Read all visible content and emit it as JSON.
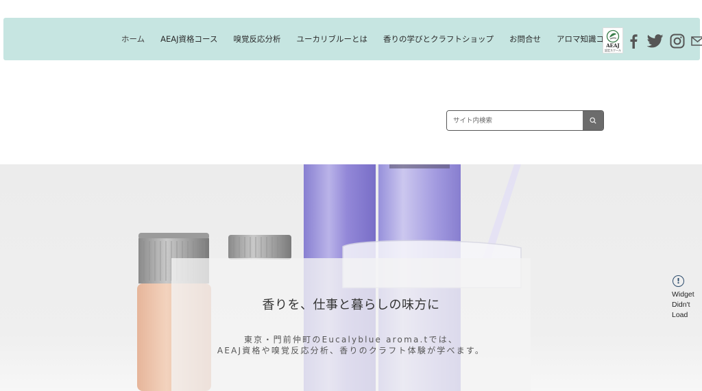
{
  "nav": {
    "items": [
      {
        "label": "ホーム"
      },
      {
        "label": "AEAJ資格コース"
      },
      {
        "label": "嗅覚反応分析"
      },
      {
        "label": "ユーカリブルーとは"
      },
      {
        "label": "香りの学びとクラフトショップ"
      },
      {
        "label": "お問合せ"
      },
      {
        "label": "アロマ知識コラム"
      }
    ]
  },
  "logo": {
    "text": "AEAJ",
    "sub": "認定スクール"
  },
  "social": {
    "icons": [
      "facebook-icon",
      "twitter-icon",
      "instagram-icon",
      "mail-icon"
    ]
  },
  "search": {
    "placeholder": "サイト内検索"
  },
  "hero": {
    "title": "香りを、仕事と暮らしの味方に",
    "line1": "東京・門前仲町のEucalyblue aroma.tでは、",
    "line2": "AEAJ資格や嗅覚反応分析、香りのクラフト体験が学べます。"
  },
  "widget": {
    "line1": "Widget",
    "line2": "Didn't",
    "line3": "Load"
  },
  "colors": {
    "nav_bg": "#c6e5e1",
    "search_button": "#6c6c6c",
    "accent_purple": "#8b7fd6"
  }
}
